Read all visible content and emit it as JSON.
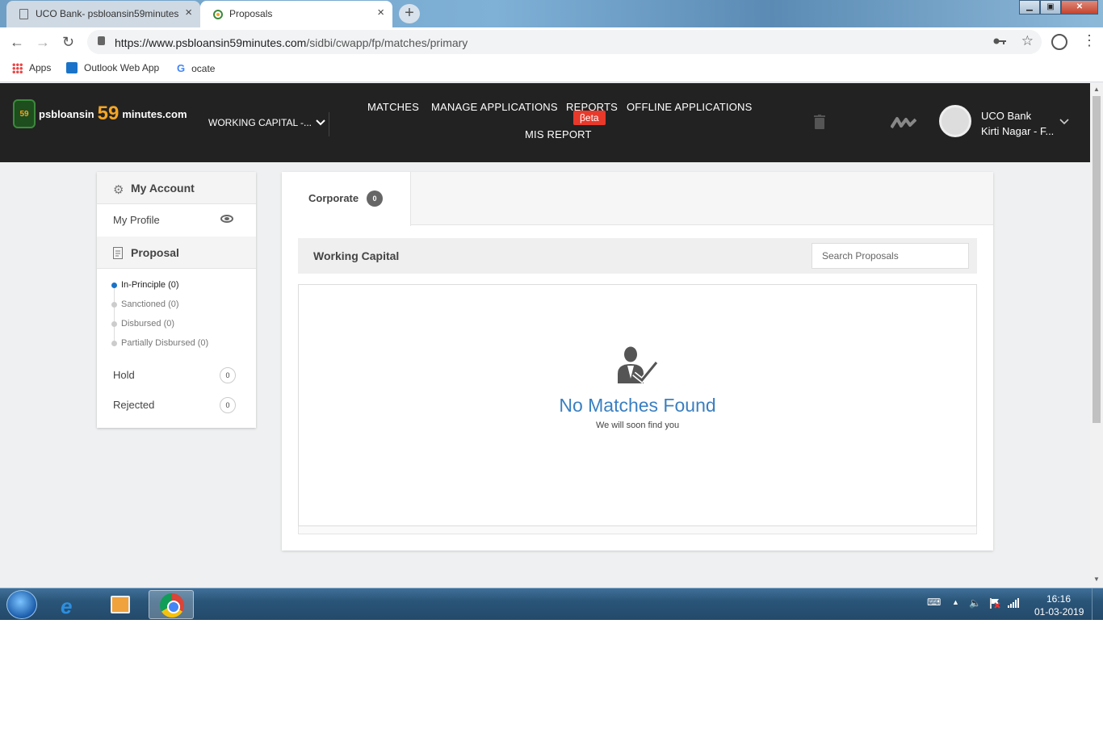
{
  "browser": {
    "tabs": [
      {
        "title": "UCO Bank- psbloansin59minutes",
        "close": "×"
      },
      {
        "title": "Proposals",
        "close": "×"
      }
    ],
    "new_tab": "+",
    "window_controls": {
      "minimize": "▁",
      "maximize": "▣",
      "close": "✕"
    },
    "nav": {
      "back": "←",
      "forward": "→",
      "reload": "↻"
    },
    "url_host": "https://www.psbloansin59minutes.com",
    "url_path": "/sidbi/cwapp/fp/matches/primary",
    "bookmarks": [
      "Apps",
      "Outlook Web App",
      "ocate"
    ],
    "icons": [
      "lock-icon",
      "key-icon",
      "star-icon",
      "account-icon",
      "menu-icon"
    ]
  },
  "site": {
    "logo_badge": "59",
    "logo_prefix": "psbloansin",
    "logo_number": "59",
    "logo_suffix": "minutes.com",
    "loan_type": "WORKING CAPITAL -...",
    "nav": {
      "matches": "MATCHES",
      "manage_applications": "MANAGE APPLICATIONS",
      "reports": "REPORTS",
      "reports_badge": "βeta",
      "offline_applications": "OFFLINE APPLICATIONS",
      "mis_report": "MIS REPORT"
    },
    "user": {
      "bank": "UCO Bank",
      "branch": "Kirti Nagar - F..."
    }
  },
  "sidebar": {
    "my_account": "My Account",
    "my_profile": "My Profile",
    "proposal": "Proposal",
    "sub_items": [
      {
        "label": "In-Principle (0)",
        "active": true
      },
      {
        "label": "Sanctioned (0)",
        "active": false
      },
      {
        "label": "Disbursed (0)",
        "active": false
      },
      {
        "label": "Partially Disbursed (0)",
        "active": false
      }
    ],
    "hold": {
      "label": "Hold",
      "count": "0"
    },
    "rejected": {
      "label": "Rejected",
      "count": "0"
    }
  },
  "main": {
    "tab_label": "Corporate",
    "tab_count": "0",
    "section_title": "Working Capital",
    "search_placeholder": "Search Proposals",
    "empty_title": "No Matches Found",
    "empty_subtitle": "We will soon find you"
  },
  "taskbar": {
    "time": "16:16",
    "date": "01-03-2019",
    "apps": [
      "internet-explorer",
      "media-player",
      "chrome"
    ]
  },
  "colors": {
    "header_bg": "#222222",
    "accent_orange": "#f5a623",
    "beta_red": "#e8392b",
    "link_blue": "#3a7fc1"
  }
}
